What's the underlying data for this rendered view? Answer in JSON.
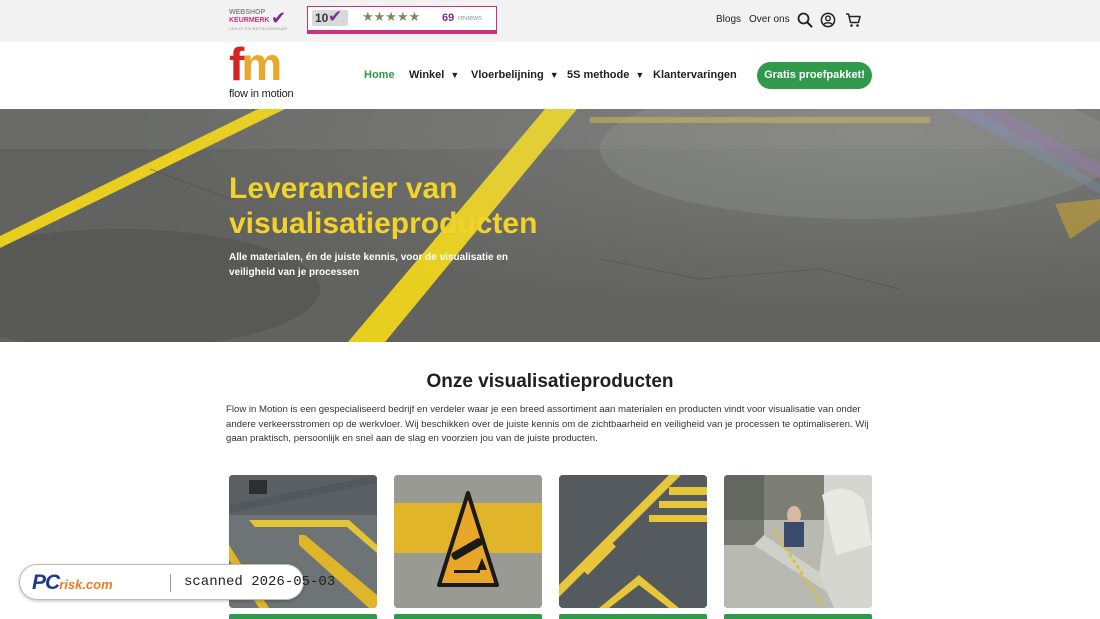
{
  "topbar": {
    "keurmerk": {
      "line1": "WEBSHOP",
      "line2": "KEURMERK",
      "sub": "VEILIG EN BETROUWBAAR"
    },
    "reviews": {
      "score": "10",
      "stars": "★★★★★",
      "count": "69",
      "label": "reviews"
    },
    "links": {
      "blogs": "Blogs",
      "about": "Over ons"
    },
    "icons": [
      "search-icon",
      "account-icon",
      "cart-icon"
    ]
  },
  "nav": {
    "logo": {
      "mark": "fm",
      "tagline": "flow in motion"
    },
    "items": [
      {
        "label": "Home",
        "active": true
      },
      {
        "label": "Winkel",
        "dropdown": true
      },
      {
        "label": "Vloerbelijning",
        "dropdown": true
      },
      {
        "label": "5S methode",
        "dropdown": true
      },
      {
        "label": "Klantervaringen"
      }
    ],
    "cta": "Gratis proefpakket!"
  },
  "hero": {
    "title": "Leverancier van visualisatieproducten",
    "subtitle": "Alle materialen, én de juiste kennis, voor de visualisatie en veiligheid van je processen"
  },
  "products": {
    "title": "Onze visualisatieproducten",
    "intro": "Flow in Motion is een gespecialiseerd bedrijf en verdeler waar je een breed assortiment aan materialen en producten vindt voor visualisatie van onder andere verkeersstromen op de werkvloer. Wij beschikken over de juiste kennis om de zichtbaarheid en veiligheid van je processen te optimaliseren. Wij gaan praktisch, persoonlijk en snel aan de slag en voorzien jou van de juiste producten."
  },
  "watermark": {
    "brand": "PC",
    "brand_suffix": "risk.com",
    "text": "scanned 2026-05-03"
  },
  "colors": {
    "accent_green": "#2f9a4c",
    "hero_yellow": "#f2d32a",
    "brand_red": "#d42521",
    "review_purple": "#7a2f8f"
  }
}
